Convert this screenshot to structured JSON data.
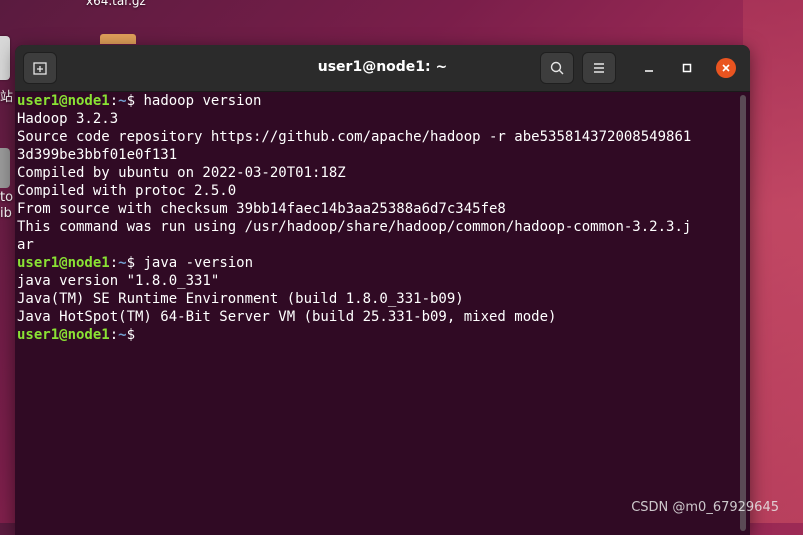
{
  "desktop": {
    "top_label": "x64.tar.gz",
    "left_label_1": "站",
    "left_label_2": "to",
    "left_label_3": "ib"
  },
  "window": {
    "title": "user1@node1: ~",
    "new_tab_icon": "new-tab-icon",
    "search_icon": "search-icon",
    "menu_icon": "hamburger-menu-icon",
    "minimize_icon": "minimize-icon",
    "maximize_icon": "maximize-icon",
    "close_icon": "close-icon",
    "close_color": "#e95420"
  },
  "terminal": {
    "background": "#300a24",
    "prompt": {
      "user": "user1@node1",
      "sep": ":",
      "path": "~",
      "symbol": "$"
    },
    "commands": [
      "hadoop version",
      "java -version",
      ""
    ],
    "hadoop_output": [
      "Hadoop 3.2.3",
      "Source code repository https://github.com/apache/hadoop -r abe535814372008549861",
      "3d399be3bbf01e0f131",
      "Compiled by ubuntu on 2022-03-20T01:18Z",
      "Compiled with protoc 2.5.0",
      "From source with checksum 39bb14faec14b3aa25388a6d7c345fe8",
      "This command was run using /usr/hadoop/share/hadoop/common/hadoop-common-3.2.3.j",
      "ar"
    ],
    "java_output": [
      "java version \"1.8.0_331\"",
      "Java(TM) SE Runtime Environment (build 1.8.0_331-b09)",
      "Java HotSpot(TM) 64-Bit Server VM (build 25.331-b09, mixed mode)"
    ]
  },
  "watermark": "CSDN @m0_67929645"
}
